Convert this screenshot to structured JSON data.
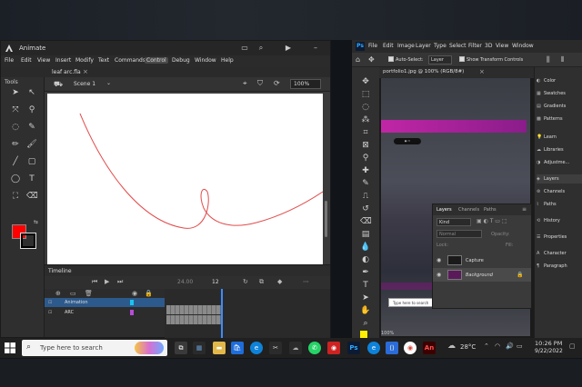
{
  "animate": {
    "app_name": "Animate",
    "menu": [
      "File",
      "Edit",
      "View",
      "Insert",
      "Modify",
      "Text",
      "Commands",
      "Control",
      "Debug",
      "Window",
      "Help"
    ],
    "active_menu": "Control",
    "doc_tab": "leaf arc.fla",
    "tools_label": "Tools",
    "scene_label": "Scene 1",
    "zoom_value": "100%",
    "timeline_label": "Timeline",
    "fps": "24.00",
    "frame_number": "12",
    "layers": [
      {
        "name": "Animation",
        "color": "#19c4f0",
        "selected": true
      },
      {
        "name": "ARC",
        "color": "#b84bd8",
        "selected": false
      }
    ],
    "stroke_color": "#e24b4b",
    "fill_color": "#ff0000"
  },
  "photoshop": {
    "app_icon": "Ps",
    "menu": [
      "File",
      "Edit",
      "Image",
      "Layer",
      "Type",
      "Select",
      "Filter",
      "3D",
      "View",
      "Window"
    ],
    "auto_select_label": "Auto-Select:",
    "auto_select_value": "Layer",
    "show_transform_label": "Show Transform Controls",
    "doc_tab": "portfolio1.jpg @ 100% (RGB/8#)",
    "right_panel": [
      "Color",
      "Swatches",
      "Gradients",
      "Patterns",
      "Learn",
      "Libraries",
      "Adjustme...",
      "Layers",
      "Channels",
      "Paths",
      "History",
      "Properties",
      "Character",
      "Paragraph"
    ],
    "layers_tabs": [
      "Layers",
      "Channels",
      "Paths"
    ],
    "kind_label": "Kind",
    "blend_mode": "Normal",
    "opacity_label": "Opacity:",
    "lock_label": "Lock:",
    "fill_label": "Fill:",
    "layers": [
      {
        "name": "Capture"
      },
      {
        "name": "Background"
      }
    ],
    "mini_search": "Type here to search",
    "zoom": "100%",
    "accent": "#c026a6"
  },
  "taskbar": {
    "search_placeholder": "Type here to search",
    "weather": "28°C",
    "time": "10:26 PM",
    "date": "9/22/2022"
  }
}
